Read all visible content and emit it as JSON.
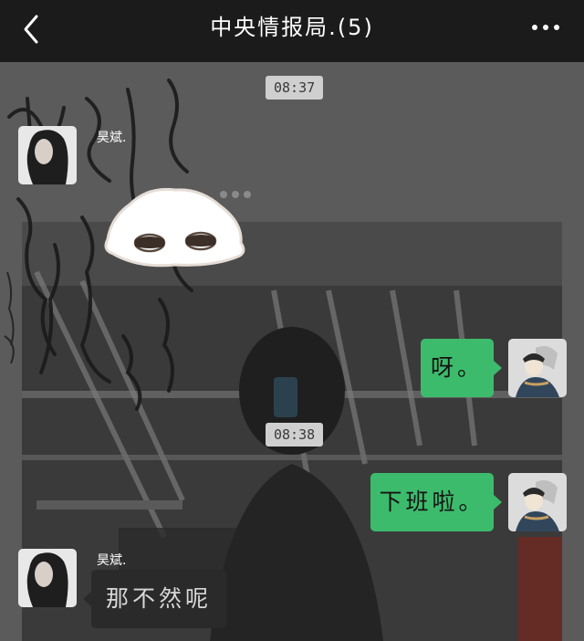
{
  "header": {
    "title": "中央情报局.(5)",
    "back_icon": "back-chevron-icon",
    "more_icon": "more-dots-icon"
  },
  "colors": {
    "header_bg": "#1b1b1b",
    "chat_bg": "#5b5b5b",
    "outgoing_bubble": "#3dbb6c",
    "incoming_bubble": "#2a2a2a",
    "timestamp_bg": "#cfcfcf"
  },
  "timestamps": [
    "08:37",
    "08:38"
  ],
  "messages": [
    {
      "direction": "incoming",
      "sender": "昊斌.",
      "type": "sticker",
      "sticker": "sleepy-blob-sticker"
    },
    {
      "direction": "outgoing",
      "text": "呀。"
    },
    {
      "direction": "outgoing",
      "text": "下班啦。"
    },
    {
      "direction": "incoming",
      "sender": "昊斌.",
      "text": "那不然呢"
    }
  ]
}
